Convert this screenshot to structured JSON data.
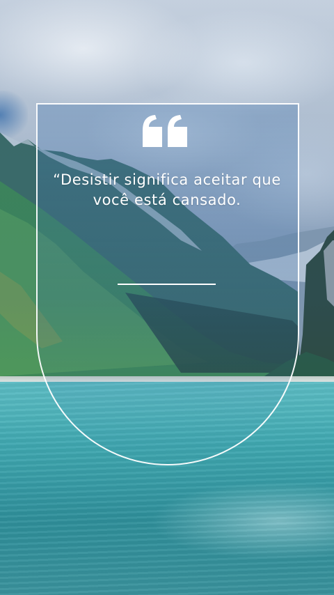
{
  "quote": {
    "text": "“Desistir significa aceitar que você está cansado."
  },
  "colors": {
    "text": "#ffffff",
    "frame": "#ffffff"
  },
  "icons": {
    "quote_mark": "quote-icon"
  }
}
